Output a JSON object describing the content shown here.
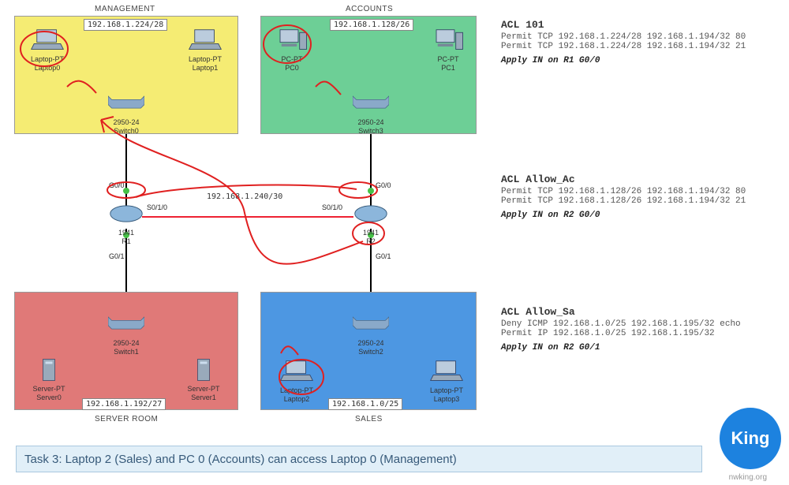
{
  "zones": {
    "management": {
      "title": "MANAGEMENT",
      "subnet": "192.168.1.224/28"
    },
    "accounts": {
      "title": "ACCOUNTS",
      "subnet": "192.168.1.128/26"
    },
    "server": {
      "title": "SERVER ROOM",
      "subnet": "192.168.1.192/27"
    },
    "sales": {
      "title": "SALES",
      "subnet": "192.168.1.0/25"
    }
  },
  "devices": {
    "laptop0": "Laptop-PT\nLaptop0",
    "laptop1": "Laptop-PT\nLaptop1",
    "switch0": "2950-24\nSwitch0",
    "pc0": "PC-PT\nPC0",
    "pc1": "PC-PT\nPC1",
    "switch3": "2950-24\nSwitch3",
    "server0": "Server-PT\nServer0",
    "server1": "Server-PT\nServer1",
    "switch1": "2950-24\nSwitch1",
    "laptop2": "Laptop-PT\nLaptop2",
    "laptop3": "Laptop-PT\nLaptop3",
    "switch2": "2950-24\nSwitch2",
    "r1": "1941\nR1",
    "r2": "1941\nR2"
  },
  "interfaces": {
    "r1_g00": "G0/0",
    "r1_s010": "S0/1/0",
    "r1_g01": "G0/1",
    "r2_g00": "G0/0",
    "r2_s010": "S0/1/0",
    "r2_g01": "G0/1"
  },
  "wan_subnet": "192.168.1.240/30",
  "acl": {
    "a101": {
      "title": "ACL 101",
      "l1": "Permit TCP 192.168.1.224/28 192.168.1.194/32 80",
      "l2": "Permit TCP 192.168.1.224/28 192.168.1.194/32 21",
      "apply": "Apply IN on R1 G0/0"
    },
    "allow_ac": {
      "title": "ACL Allow_Ac",
      "l1": "Permit TCP 192.168.1.128/26 192.168.1.194/32 80",
      "l2": "Permit TCP 192.168.1.128/26 192.168.1.194/32 21",
      "apply": "Apply IN on R2 G0/0"
    },
    "allow_sa": {
      "title": "ACL Allow_Sa",
      "l1": "Deny ICMP 192.168.1.0/25 192.168.1.195/32 echo",
      "l2": "Permit IP 192.168.1.0/25 192.168.1.195/32",
      "apply": "Apply IN on R2 G0/1"
    }
  },
  "task": "Task 3: Laptop 2 (Sales) and PC 0 (Accounts) can access Laptop 0 (Management)",
  "logo": "King",
  "watermark": "nwking.org"
}
